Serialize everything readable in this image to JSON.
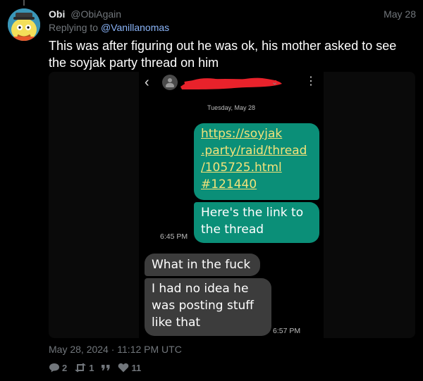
{
  "post": {
    "name": "Obi",
    "handle": "@ObiAgain",
    "date": "May 28",
    "replying_prefix": "Replying to",
    "replying_to": "@Vanillanomas",
    "text": "This was after figuring out he was ok, his mother asked to see the soyjak party thread on him",
    "posted_at": "May 28, 2024 · 11:12 PM UTC"
  },
  "screenshot": {
    "day_label": "Tuesday, May 28",
    "outgoing": {
      "link_lines": [
        "https://soyjak",
        ".party/raid/thread",
        "/105725.html",
        "#121440"
      ],
      "message": "Here's the link to the thread",
      "time": "6:45 PM"
    },
    "incoming": {
      "message1": "What in the fuck",
      "message2": "I had no idea he was posting stuff like that",
      "time": "6:57 PM"
    }
  },
  "stats": {
    "replies": "2",
    "reposts": "1",
    "likes": "11"
  },
  "colors": {
    "outgoing_bubble": "#0b8f78",
    "incoming_bubble": "#3c3c3c",
    "link": "#f2e27a",
    "redaction": "#e8222b"
  }
}
